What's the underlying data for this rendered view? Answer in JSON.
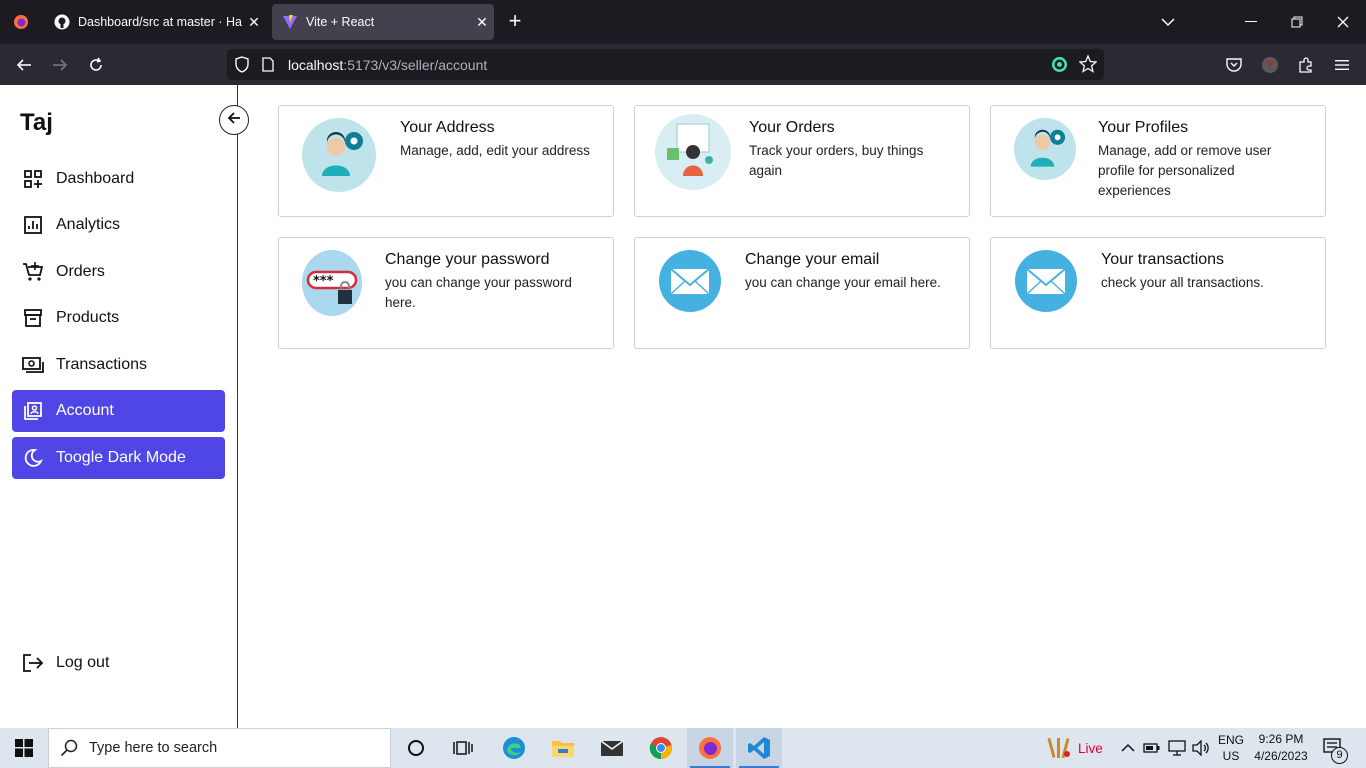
{
  "browser": {
    "tabs": [
      {
        "title": "Dashboard/src at master · Hayat",
        "active": false,
        "favicon": "github-icon"
      },
      {
        "title": "Vite + React",
        "active": true,
        "favicon": "vite-icon"
      }
    ],
    "url_host": "localhost",
    "url_path": ":5173/v3/seller/account"
  },
  "sidebar": {
    "brand": "Taj",
    "items": [
      {
        "label": "Dashboard",
        "icon": "dashboard-icon"
      },
      {
        "label": "Analytics",
        "icon": "analytics-icon"
      },
      {
        "label": "Orders",
        "icon": "cart-icon"
      },
      {
        "label": "Products",
        "icon": "archive-icon"
      },
      {
        "label": "Transactions",
        "icon": "money-icon"
      },
      {
        "label": "Account",
        "icon": "account-icon",
        "active": true
      },
      {
        "label": "Toogle Dark Mode",
        "icon": "moon-icon",
        "active": true
      }
    ],
    "logout": "Log out"
  },
  "cards": [
    {
      "title": "Your Address",
      "desc": "Manage, add, edit your address",
      "image": "user-settings-illustration"
    },
    {
      "title": "Your Orders",
      "desc": "Track your orders, buy things again",
      "image": "orders-illustration"
    },
    {
      "title": "Your Profiles",
      "desc": "Manage, add or remove user profile for personalized experiences",
      "image": "user-settings-illustration"
    },
    {
      "title": "Change your password",
      "desc": "you can change your password here.",
      "image": "password-illustration"
    },
    {
      "title": "Change your email",
      "desc": "you can change your email here.",
      "image": "envelope-illustration"
    },
    {
      "title": "Your transactions",
      "desc": "check your all transactions.",
      "image": "envelope-illustration"
    }
  ],
  "colors": {
    "accent": "#4f46e5",
    "circle": "#bfe3ea",
    "mail": "#45b1e0"
  },
  "taskbar": {
    "search_placeholder": "Type here to search",
    "live": "Live",
    "lang": "ENG",
    "region": "US",
    "time": "9:26 PM",
    "date": "4/26/2023",
    "notifications": "9"
  }
}
